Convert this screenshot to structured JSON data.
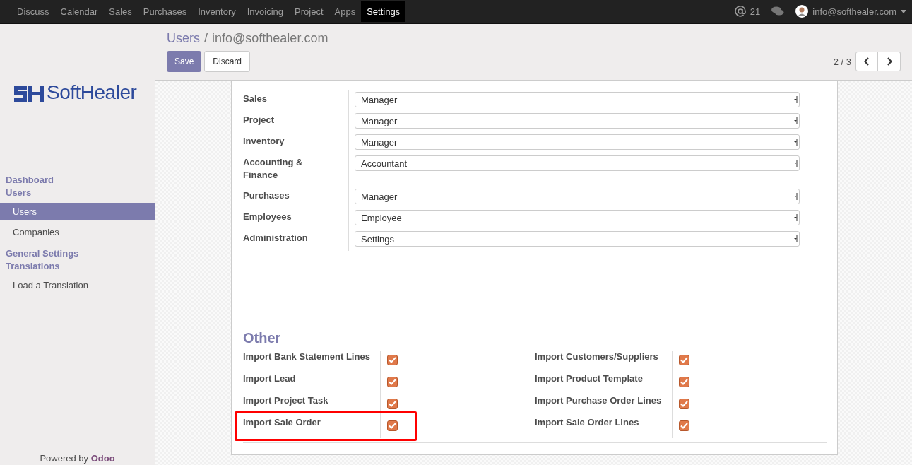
{
  "top_menu": [
    {
      "label": "Discuss",
      "selected": false
    },
    {
      "label": "Calendar",
      "selected": false
    },
    {
      "label": "Sales",
      "selected": false
    },
    {
      "label": "Purchases",
      "selected": false
    },
    {
      "label": "Inventory",
      "selected": false
    },
    {
      "label": "Invoicing",
      "selected": false
    },
    {
      "label": "Project",
      "selected": false
    },
    {
      "label": "Apps",
      "selected": false
    },
    {
      "label": "Settings",
      "selected": true
    }
  ],
  "systray": {
    "mentions": "21",
    "user": "info@softhealer.com"
  },
  "sidebar": {
    "logo": "SoftHealer",
    "sections": [
      {
        "label": "Dashboard"
      },
      {
        "label": "Users",
        "children": [
          {
            "label": "Users",
            "selected": true
          },
          {
            "label": "Companies",
            "selected": false
          }
        ]
      },
      {
        "label": "General Settings"
      },
      {
        "label": "Translations",
        "children": [
          {
            "label": "Load a Translation",
            "selected": false
          }
        ]
      }
    ],
    "powered_by": {
      "text": "Powered by",
      "link": "Odoo"
    }
  },
  "control_panel": {
    "breadcrumb": [
      "Users",
      "info@softhealer.com"
    ],
    "breadcrumb_separator": "/",
    "buttons": [
      {
        "label": "Save",
        "kind": "primary"
      },
      {
        "label": "Discard",
        "kind": "secondary"
      }
    ],
    "pager": "2 / 3"
  },
  "application": [
    {
      "label": "Sales",
      "value": "Manager"
    },
    {
      "label": "Project",
      "value": "Manager"
    },
    {
      "label": "Inventory",
      "value": "Manager"
    },
    {
      "label": "Accounting & Finance",
      "value": "Accountant"
    },
    {
      "label": "Purchases",
      "value": "Manager"
    },
    {
      "label": "Employees",
      "value": "Employee"
    },
    {
      "label": "Administration",
      "value": "Settings"
    }
  ],
  "other": {
    "title": "Other",
    "left": [
      {
        "label": "Import Bank Statement Lines",
        "checked": true,
        "highlighted": false
      },
      {
        "label": "Import Lead",
        "checked": true,
        "highlighted": false
      },
      {
        "label": "Import Project Task",
        "checked": true,
        "highlighted": false
      },
      {
        "label": "Import Sale Order",
        "checked": true,
        "highlighted": true
      }
    ],
    "right": [
      {
        "label": "Import Customers/Suppliers",
        "checked": true,
        "highlighted": false
      },
      {
        "label": "Import Product Template",
        "checked": true,
        "highlighted": false
      },
      {
        "label": "Import Purchase Order Lines",
        "checked": true,
        "highlighted": false
      },
      {
        "label": "Import Sale Order Lines",
        "checked": true,
        "highlighted": false
      }
    ]
  }
}
